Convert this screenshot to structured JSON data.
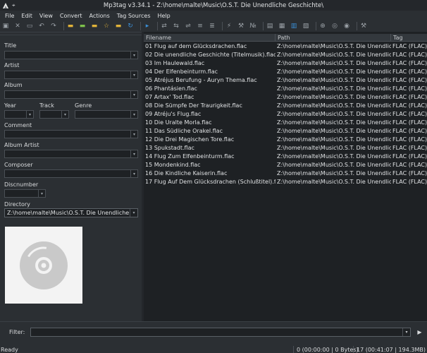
{
  "window": {
    "title": "Mp3tag v3.34.1 - Z:\\home\\malte\\Music\\O.S.T. Die Unendliche Geschichte\\"
  },
  "menu": [
    "File",
    "Edit",
    "View",
    "Convert",
    "Actions",
    "Tag Sources",
    "Help"
  ],
  "tag_panel": {
    "title_label": "Title",
    "artist_label": "Artist",
    "album_label": "Album",
    "year_label": "Year",
    "track_label": "Track",
    "genre_label": "Genre",
    "comment_label": "Comment",
    "album_artist_label": "Album Artist",
    "composer_label": "Composer",
    "discnumber_label": "Discnumber",
    "directory_label": "Directory",
    "directory_value": "Z:\\home\\malte\\Music\\O.S.T. Die Unendliche Geschi"
  },
  "file_list": {
    "columns": [
      "Filename",
      "Path",
      "Tag"
    ],
    "rows": [
      {
        "filename": "01 Flug auf dem Glücksdrachen.flac",
        "path": "Z:\\home\\malte\\Music\\O.S.T. Die Unendlic...",
        "tag": "FLAC (FLAC)"
      },
      {
        "filename": "02 Die unendliche Geschichte (Titelmusik).flac",
        "path": "Z:\\home\\malte\\Music\\O.S.T. Die Unendlic...",
        "tag": "FLAC (FLAC)"
      },
      {
        "filename": "03 Im Haulewald.flac",
        "path": "Z:\\home\\malte\\Music\\O.S.T. Die Unendlic...",
        "tag": "FLAC (FLAC)"
      },
      {
        "filename": "04 Der Elfenbeinturm.flac",
        "path": "Z:\\home\\malte\\Music\\O.S.T. Die Unendlic...",
        "tag": "FLAC (FLAC)"
      },
      {
        "filename": "05 Atréjus Berufung - Auryn Thema.flac",
        "path": "Z:\\home\\malte\\Music\\O.S.T. Die Unendlic...",
        "tag": "FLAC (FLAC)"
      },
      {
        "filename": "06 Phantásien.flac",
        "path": "Z:\\home\\malte\\Music\\O.S.T. Die Unendlic...",
        "tag": "FLAC (FLAC)"
      },
      {
        "filename": "07 Artax' Tod.flac",
        "path": "Z:\\home\\malte\\Music\\O.S.T. Die Unendlic...",
        "tag": "FLAC (FLAC)"
      },
      {
        "filename": "08 Die Sümpfe Der Traurigkeit.flac",
        "path": "Z:\\home\\malte\\Music\\O.S.T. Die Unendlic...",
        "tag": "FLAC (FLAC)"
      },
      {
        "filename": "09 Atréju's Flug.flac",
        "path": "Z:\\home\\malte\\Music\\O.S.T. Die Unendlic...",
        "tag": "FLAC (FLAC)"
      },
      {
        "filename": "10 Die Uralte Morla.flac",
        "path": "Z:\\home\\malte\\Music\\O.S.T. Die Unendlic...",
        "tag": "FLAC (FLAC)"
      },
      {
        "filename": "11 Das Südliche Orakel.flac",
        "path": "Z:\\home\\malte\\Music\\O.S.T. Die Unendlic...",
        "tag": "FLAC (FLAC)"
      },
      {
        "filename": "12 Die Drei Magischen Tore.flac",
        "path": "Z:\\home\\malte\\Music\\O.S.T. Die Unendlic...",
        "tag": "FLAC (FLAC)"
      },
      {
        "filename": "13 Spukstadt.flac",
        "path": "Z:\\home\\malte\\Music\\O.S.T. Die Unendlic...",
        "tag": "FLAC (FLAC)"
      },
      {
        "filename": "14 Flug Zum Elfenbeinturm.flac",
        "path": "Z:\\home\\malte\\Music\\O.S.T. Die Unendlic...",
        "tag": "FLAC (FLAC)"
      },
      {
        "filename": "15 Mondenkind.flac",
        "path": "Z:\\home\\malte\\Music\\O.S.T. Die Unendlic...",
        "tag": "FLAC (FLAC)"
      },
      {
        "filename": "16 Die Kindliche Kaiserin.flac",
        "path": "Z:\\home\\malte\\Music\\O.S.T. Die Unendlic...",
        "tag": "FLAC (FLAC)"
      },
      {
        "filename": "17 Flug Auf Dem Glücksdrachen (Schlußtitel).flac",
        "path": "Z:\\home\\malte\\Music\\O.S.T. Die Unendlic...",
        "tag": "FLAC (FLAC)"
      }
    ]
  },
  "filter": {
    "label": "Filter:",
    "value": ""
  },
  "status": {
    "left": "Ready",
    "selection": "0 (00:00:00 | 0 Bytes)",
    "total": "17 (00:41:07 | 194.3MB)"
  },
  "colors": {
    "background": "#2b2f33",
    "list_background": "#1e2124",
    "accent_blue": "#3b8fd6",
    "folder_yellow": "#e0b23a"
  }
}
